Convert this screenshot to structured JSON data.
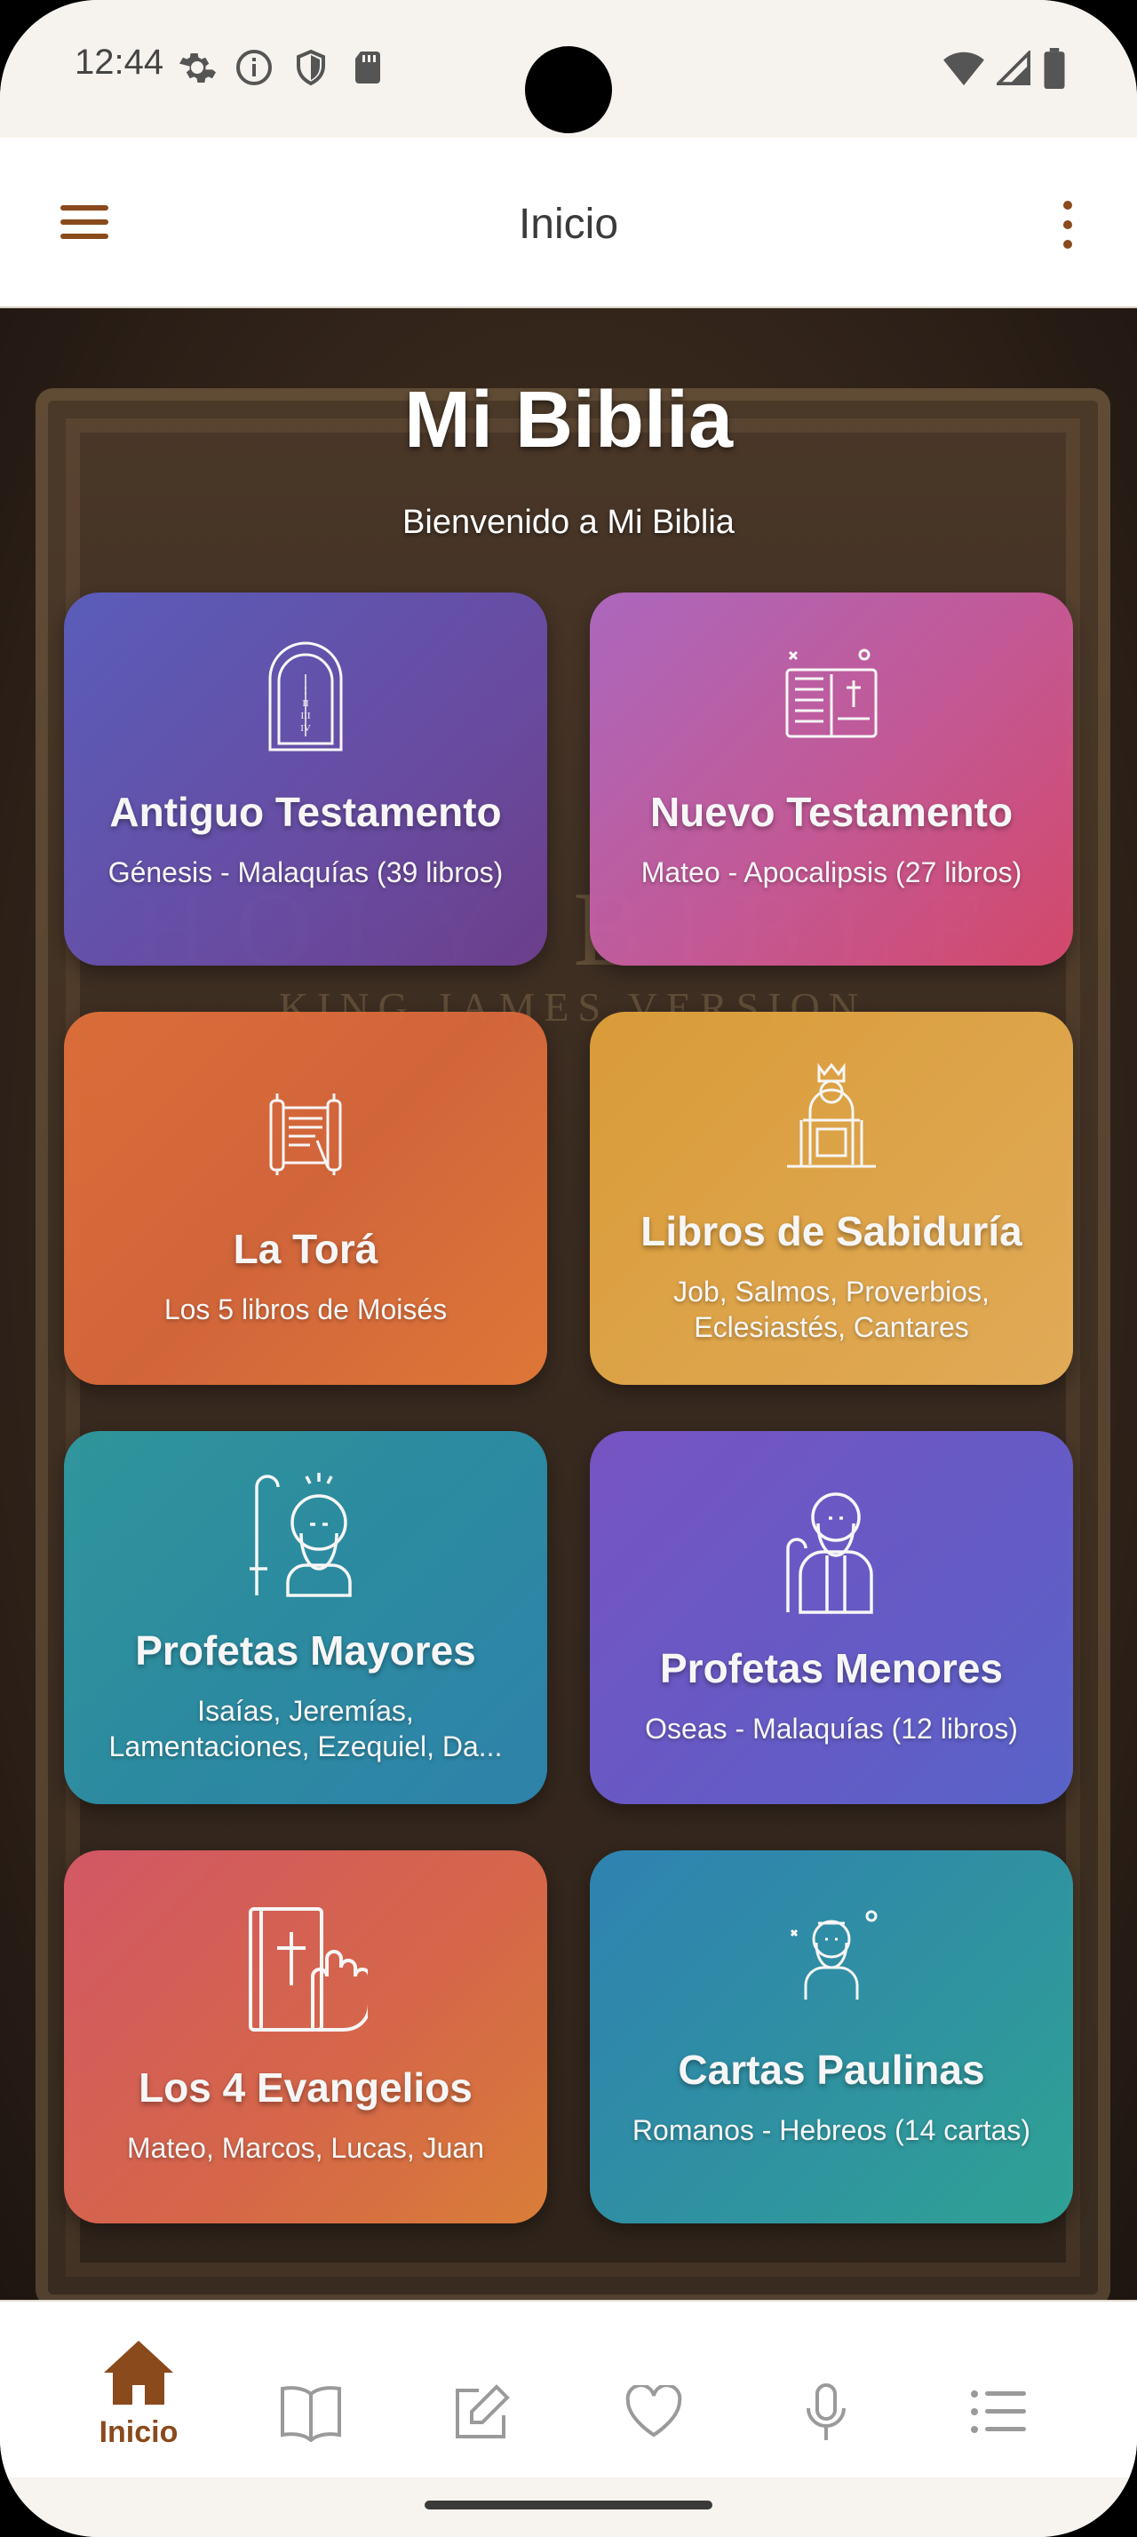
{
  "status_bar": {
    "time": "12:44",
    "left_icons": [
      "settings-icon",
      "info-icon",
      "shield-icon",
      "sd-card-icon"
    ],
    "right_icons": [
      "wifi-icon",
      "cell-signal-icon",
      "battery-icon"
    ]
  },
  "app_bar": {
    "title": "Inicio",
    "menu_icon": "hamburger-menu-icon",
    "more_icon": "more-vert-icon"
  },
  "hero": {
    "title": "Mi Biblia",
    "subtitle": "Bienvenido a Mi Biblia"
  },
  "background_cover_text": {
    "line1": "HOLY BIBLE",
    "line2": "KING JAMES VERSION"
  },
  "cards": [
    {
      "title": "Antiguo Testamento",
      "subtitle": "Génesis - Malaquías (39 libros)",
      "icon": "tablets-icon"
    },
    {
      "title": "Nuevo Testamento",
      "subtitle": "Mateo - Apocalipsis (27 libros)",
      "icon": "open-bible-icon"
    },
    {
      "title": "La Torá",
      "subtitle": "Los 5 libros de Moisés",
      "icon": "torah-scroll-icon"
    },
    {
      "title": "Libros de Sabiduría",
      "subtitle": "Job, Salmos, Proverbios, Eclesiastés, Cantares",
      "icon": "king-throne-icon"
    },
    {
      "title": "Profetas Mayores",
      "subtitle": "Isaías, Jeremías, Lamentaciones, Ezequiel, Da...",
      "icon": "prophet-staff-icon"
    },
    {
      "title": "Profetas Menores",
      "subtitle": "Oseas - Malaquías (12 libros)",
      "icon": "prophet-icon"
    },
    {
      "title": "Los 4 Evangelios",
      "subtitle": "Mateo, Marcos, Lucas, Juan",
      "icon": "bible-hand-icon"
    },
    {
      "title": "Cartas Paulinas",
      "subtitle": "Romanos - Hebreos (14 cartas)",
      "icon": "apostle-icon"
    }
  ],
  "bottom_nav": [
    {
      "label": "Inicio",
      "icon": "home-icon",
      "active": true
    },
    {
      "label": "",
      "icon": "book-icon",
      "active": false
    },
    {
      "label": "",
      "icon": "edit-note-icon",
      "active": false
    },
    {
      "label": "",
      "icon": "heart-icon",
      "active": false
    },
    {
      "label": "",
      "icon": "microphone-icon",
      "active": false
    },
    {
      "label": "",
      "icon": "list-icon",
      "active": false
    }
  ],
  "colors": {
    "accent": "#8a4a1c",
    "inactive_icon": "#9a9a9a"
  }
}
